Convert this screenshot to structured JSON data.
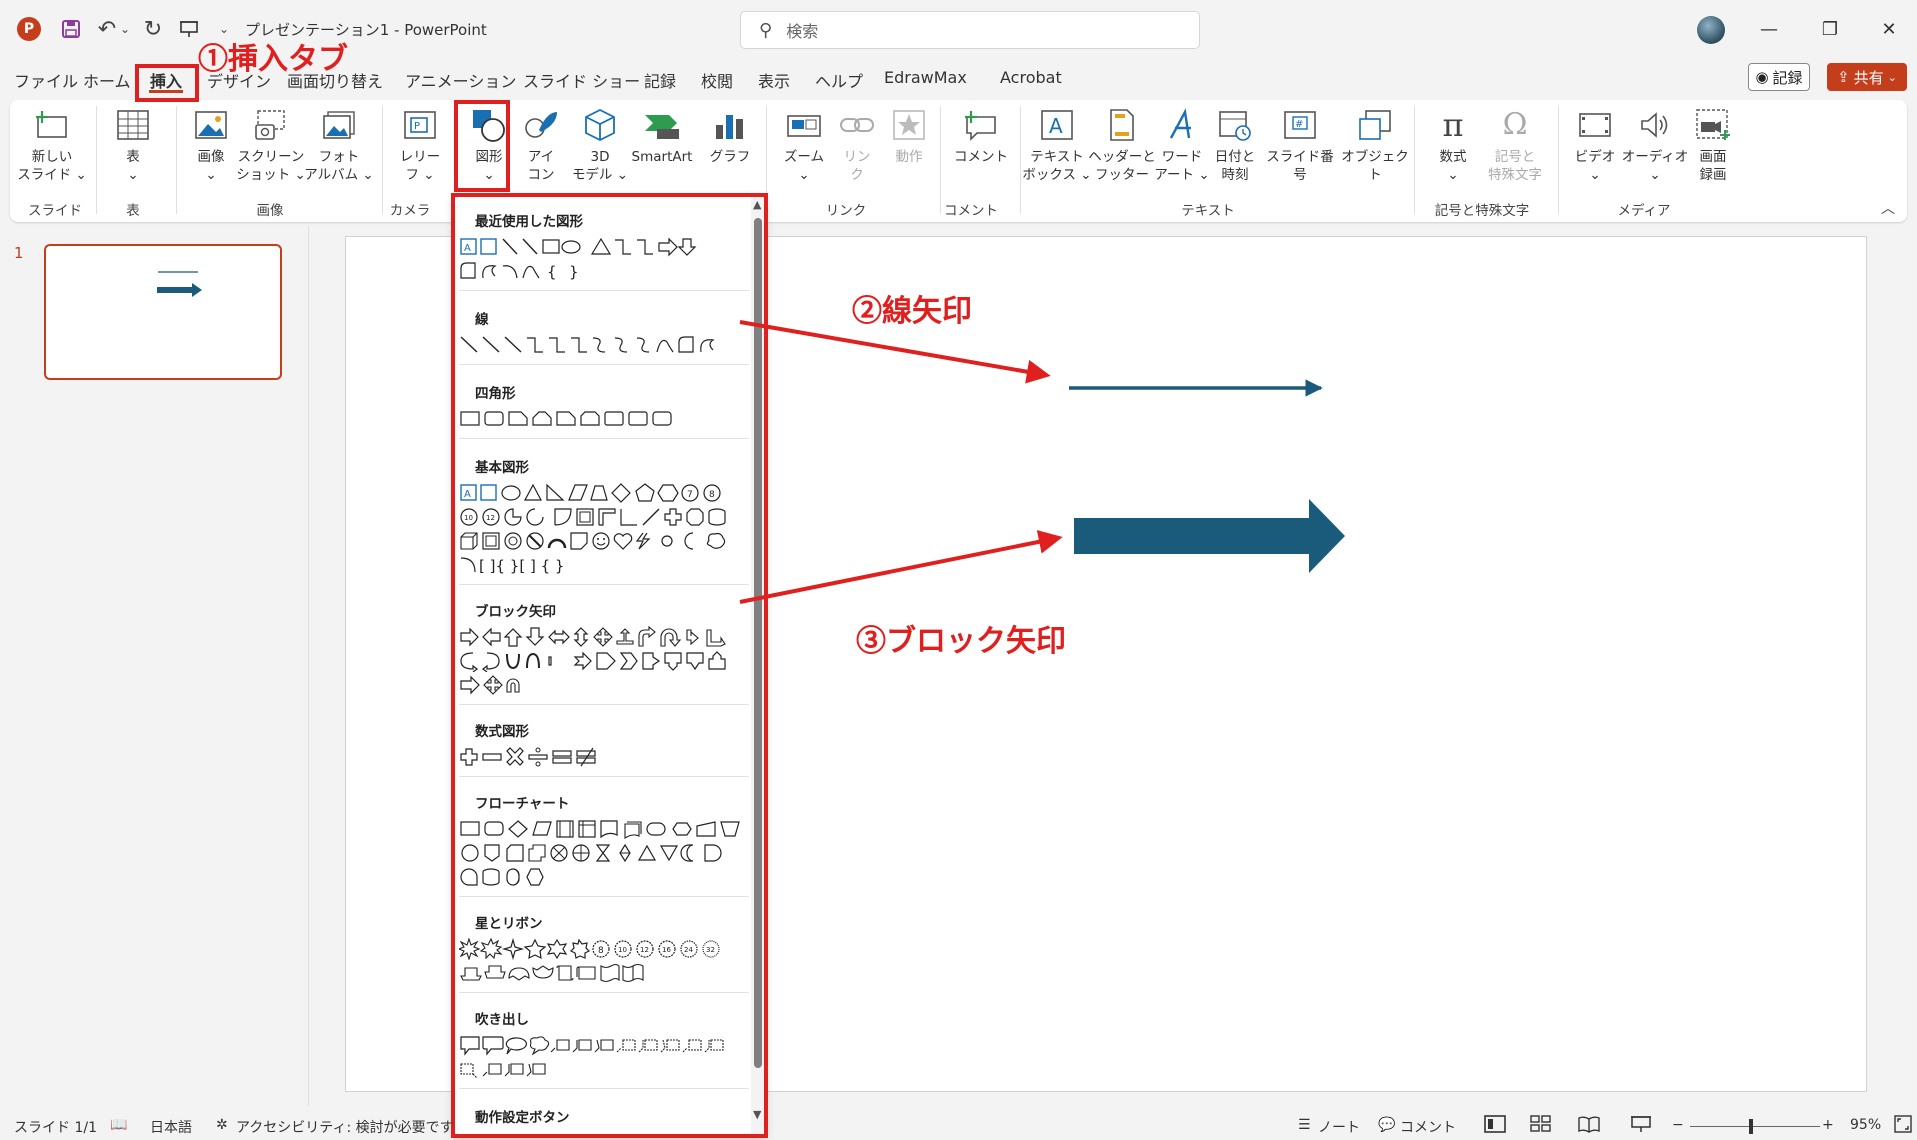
{
  "titlebar": {
    "title": "プレゼンテーション1  -  PowerPoint",
    "search_placeholder": "検索",
    "logo_letter": "P"
  },
  "menu": {
    "tabs": [
      "ファイル",
      "ホーム",
      "挿入",
      "デザイン",
      "画面切り替え",
      "アニメーション",
      "スライド ショー",
      "記録",
      "校閲",
      "表示",
      "ヘルプ",
      "EdrawMax",
      "Acrobat"
    ],
    "record_label": "記録",
    "share_label": "共有"
  },
  "ribbon": {
    "new_slide": "新しい\nスライド ⌄",
    "table": "表\n⌄",
    "image": "画像\n⌄",
    "screenshot": "スクリーン\nショット ⌄",
    "photo_album": "フォト\nアルバム ⌄",
    "cameo": "レリー\nフ ⌄",
    "shapes": "図形\n⌄",
    "icons": "アイ\nコン",
    "3d_models": "3D\nモデル ⌄",
    "smartart": "SmartArt",
    "chart": "グラフ",
    "zoom": "ズーム\n⌄",
    "link": "リン\nク",
    "action": "動作",
    "comment": "コメント",
    "textbox": "テキスト\nボックス ⌄",
    "header_footer": "ヘッダーと\nフッター",
    "wordart": "ワード\nアート ⌄",
    "date_time": "日付と\n時刻",
    "slide_number": "スライド番号",
    "object": "オブジェクト",
    "equation": "数式\n⌄",
    "symbol": "記号と\n特殊文字",
    "video": "ビデオ\n⌄",
    "audio": "オーディオ\n⌄",
    "screen_recording": "画面\n録画",
    "groups": {
      "slides": "スライド",
      "tables": "表",
      "images": "画像",
      "camera": "カメラ",
      "links": "リンク",
      "comments": "コメント",
      "text": "テキスト",
      "symbols": "記号と特殊文字",
      "media": "メディア"
    }
  },
  "slide_pane": {
    "slide_number": "1"
  },
  "shapes_dropdown": {
    "sections": [
      {
        "title": "最近使用した図形",
        "rows": [
          "▭▭﹨﹨□○△⌐⌐⇨⇩",
          "◠◡◟◝{ }"
        ]
      },
      {
        "title": "線",
        "rows": [
          "﹨﹨﹨⌐⌐⌐ᒧᒧᒧ⌒◡◡"
        ]
      },
      {
        "title": "四角形",
        "rows": [
          "▭▭▭▭▭▭▭▭▭"
        ]
      },
      {
        "title": "基本図形",
        "rows": [
          "▭▭○△◺▱⏢◇⬠⬡⑦⑧",
          "⑩⑫◔◑◐▣◸◹◿✚⬭▯",
          "◫▣◎⊘⌒◪☺♡ϟ☼☾✿",
          "⌒[ ]{ }[ ] { }"
        ]
      },
      {
        "title": "ブロック矢印",
        "rows": [
          "⇨⇦⇧⇩⇔⇕✥⊥↱↶↲↳",
          "↺↻↶↷⇨⇨▷▷⇨⇩⇩⇧",
          "⇨✥↶"
        ]
      },
      {
        "title": "数式図形",
        "rows": [
          "✚━✖➗☰⊭"
        ]
      },
      {
        "title": "フローチャート",
        "rows": [
          "▭▭◇▱▯▯▭▭⬭⬭⏢▽",
          "○⬠◸▭⊗⊕⧗◆△▽◗◖",
          "◯⛁◫○"
        ]
      },
      {
        "title": "星とリボン",
        "rows": [
          "✸✹✦☆☆☆⑧⑩⑫⑯⑳㉔",
          "⛿⛿⛿⛿⛿⛿▯▯"
        ]
      },
      {
        "title": "吹き出し",
        "rows": [
          "▭▭○☁◪◪◪◪◪◪◪◪",
          "◪◪◪◪"
        ]
      },
      {
        "title": "動作設定ボタン",
        "rows": []
      }
    ]
  },
  "annotations": {
    "insert_tab": "①挿入タブ",
    "line_arrow": "②線矢印",
    "block_arrow": "③ブロック矢印",
    "color": "#e0201e"
  },
  "slide": {
    "arrow_color": "#1a5b7c"
  },
  "statusbar": {
    "slide_info": "スライド 1/1",
    "language": "日本語",
    "accessibility": "アクセシビリティ: 検討が必要です",
    "notes": "ノート",
    "comments": "コメント",
    "zoom_minus": "−",
    "zoom_plus": "+",
    "zoom_level": "95%"
  },
  "colors": {
    "accent": "#c43e1c",
    "slide_shape": "#1a5b7c"
  }
}
